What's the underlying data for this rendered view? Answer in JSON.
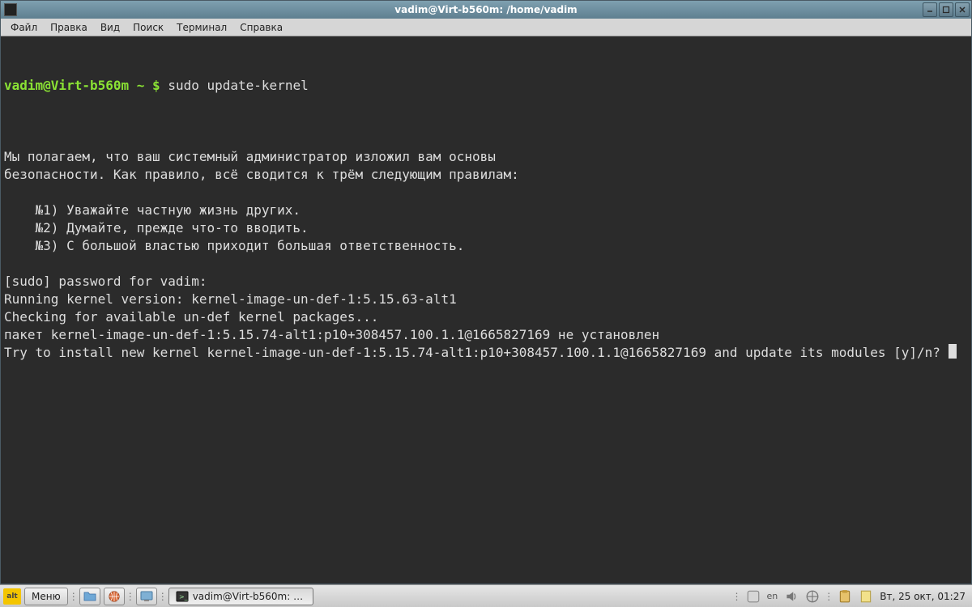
{
  "window": {
    "title": "vadim@Virt-b560m: /home/vadim"
  },
  "menubar": {
    "items": [
      "Файл",
      "Правка",
      "Вид",
      "Поиск",
      "Терминал",
      "Справка"
    ]
  },
  "terminal": {
    "prompt_user_host": "vadim@Virt-b560m",
    "prompt_path": "~",
    "prompt_symbol": "$",
    "command": "sudo update-kernel",
    "lines": [
      "",
      "Мы полагаем, что ваш системный администратор изложил вам основы",
      "безопасности. Как правило, всё сводится к трём следующим правилам:",
      "",
      "    №1) Уважайте частную жизнь других.",
      "    №2) Думайте, прежде что-то вводить.",
      "    №3) С большой властью приходит большая ответственность.",
      "",
      "[sudo] password for vadim: ",
      "Running kernel version: kernel-image-un-def-1:5.15.63-alt1",
      "Checking for available un-def kernel packages...",
      "пакет kernel-image-un-def-1:5.15.74-alt1:p10+308457.100.1.1@1665827169 не установлен",
      "Try to install new kernel kernel-image-un-def-1:5.15.74-alt1:p10+308457.100.1.1@1665827169 and update its modules [y]/n? "
    ]
  },
  "taskbar": {
    "menu_label": "Меню",
    "task_label": "vadim@Virt-b560m: /home...",
    "lang": "en",
    "clock": "Вт, 25 окт, 01:27"
  }
}
